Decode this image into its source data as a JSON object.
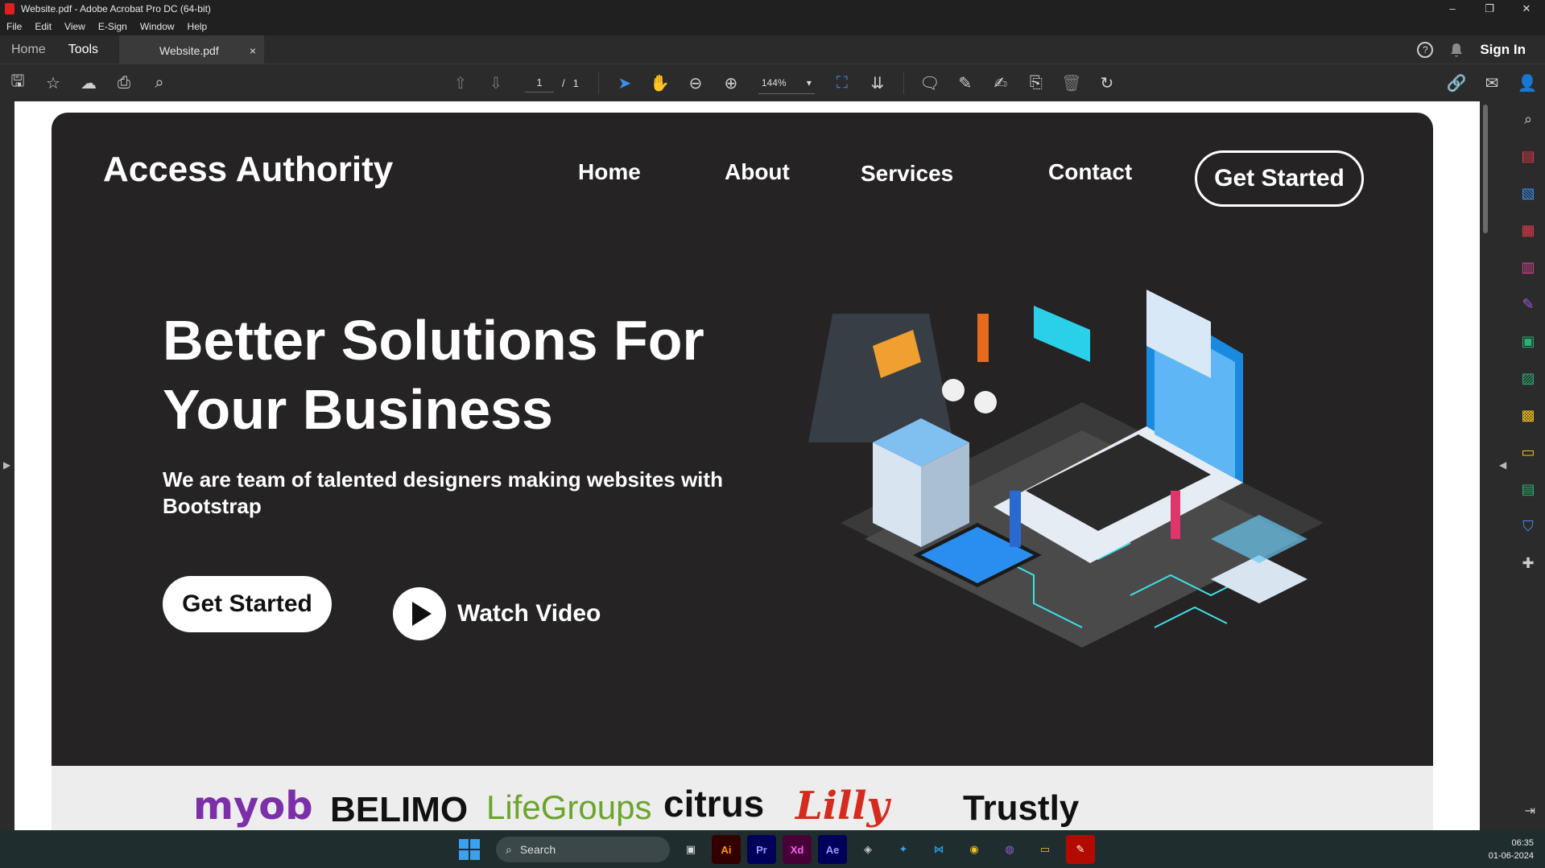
{
  "window": {
    "title": "Website.pdf - Adobe Acrobat Pro DC (64-bit)",
    "controls": [
      "–",
      "❐",
      "✕"
    ]
  },
  "menu": [
    "File",
    "Edit",
    "View",
    "E-Sign",
    "Window",
    "Help"
  ],
  "tabs": {
    "home": "Home",
    "tools": "Tools",
    "document": "Website.pdf",
    "close": "×",
    "signin": "Sign In",
    "help": "?"
  },
  "toolbar": {
    "page_current": "1",
    "page_sep": "/",
    "page_total": "1",
    "zoom": "144%"
  },
  "page": {
    "brand": "Access Authority",
    "nav": [
      "Home",
      "About",
      "Services",
      "Contact"
    ],
    "nav_button": "Get Started",
    "headline_1": "Better Solutions For",
    "headline_2": "Your Business",
    "subheading": "We are team of talented designers making websites with Bootstrap",
    "cta": "Get Started",
    "watch": "Watch Video",
    "logos": [
      "myob",
      "BELIMO",
      "LifeGroups",
      "citrus",
      "Lilly",
      "Trustly"
    ],
    "colors": {
      "hero_bg": "#252324",
      "logos_bg": "#ededed",
      "myob": "#7b2fa8",
      "belimo": "#111111",
      "belimo_accent": "#e8561a",
      "lifegroups": "#6aa52c",
      "citrus": "#111111",
      "lilly": "#d52b1e",
      "trustly": "#111111",
      "trustly_icon": "#2ab84a"
    }
  },
  "taskbar": {
    "search": "Search",
    "apps": [
      "Ai",
      "Pr",
      "Xd",
      "Ae"
    ],
    "time": "06:35",
    "date": "01-06-2024"
  }
}
